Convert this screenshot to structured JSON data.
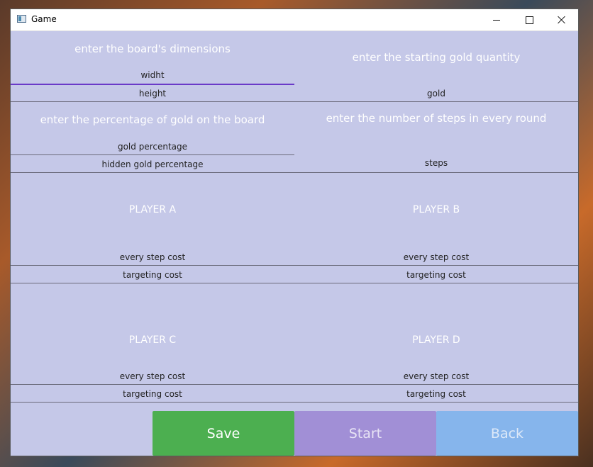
{
  "window": {
    "title": "Game"
  },
  "section_board": {
    "heading": "enter the board's dimensions",
    "width_value": "widht",
    "height_value": "height"
  },
  "section_gold": {
    "heading": "enter the starting gold quantity",
    "gold_value": "gold"
  },
  "section_percentage": {
    "heading": "enter the percentage of gold on the board",
    "gold_pct_value": "gold percentage",
    "hidden_pct_value": "hidden gold percentage"
  },
  "section_steps": {
    "heading": "enter the number of steps in every round",
    "steps_value": "steps"
  },
  "players": [
    {
      "label": "PLAYER A",
      "step_cost": "every step cost",
      "targeting_cost": "targeting cost"
    },
    {
      "label": "PLAYER B",
      "step_cost": "every step cost",
      "targeting_cost": "targeting cost"
    },
    {
      "label": "PLAYER C",
      "step_cost": "every step cost",
      "targeting_cost": "targeting cost"
    },
    {
      "label": "PLAYER D",
      "step_cost": "every step cost",
      "targeting_cost": "targeting cost"
    }
  ],
  "buttons": {
    "save": "Save",
    "start": "Start",
    "back": "Back"
  },
  "colors": {
    "panel": "#c5c8e8",
    "save": "#4caf50",
    "start": "#a18fd6",
    "back": "#86b5ec",
    "focus_underline": "#6a3ac8"
  }
}
